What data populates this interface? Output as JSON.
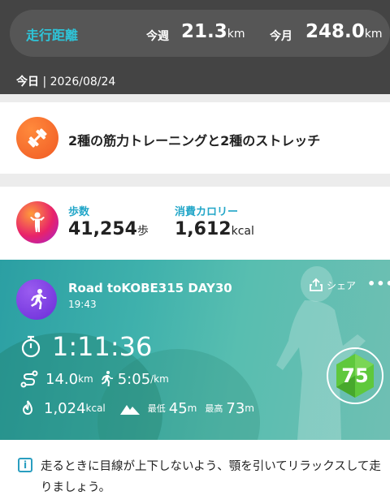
{
  "distance": {
    "label": "走行距離",
    "week_label": "今週",
    "week_value": "21.3",
    "week_unit": "km",
    "month_label": "今月",
    "month_value": "248.0",
    "month_unit": "km"
  },
  "today": {
    "label": "今日",
    "separator": " | ",
    "date": "2026/08/24"
  },
  "workout": {
    "icon": "dumbbell-icon",
    "title": "2種の筋力トレーニングと2種のストレッチ"
  },
  "activity": {
    "icon": "person-icon",
    "steps_label": "歩数",
    "steps_value": "41,254",
    "steps_unit": "歩",
    "calories_label": "消費カロリー",
    "calories_value": "1,612",
    "calories_unit": "kcal"
  },
  "run": {
    "icon": "running-icon",
    "title": "Road toKOBE315 DAY30",
    "time": "19:43",
    "share_label": "シェア",
    "more_label": "•••",
    "duration": "1:11:36",
    "distance_value": "14.0",
    "distance_unit": "km",
    "pace_value": "5:05",
    "pace_unit": "/km",
    "calories_value": "1,024",
    "calories_unit": "kcal",
    "elev_min_label": "最低",
    "elev_min_value": "45",
    "elev_min_unit": "m",
    "elev_max_label": "最高",
    "elev_max_value": "73",
    "elev_max_unit": "m",
    "score": "75",
    "accent_color": "#5fc83c"
  },
  "tip": {
    "icon": "info-icon",
    "text": "走るときに目線が上下しないよう、顎を引いてリラックスして走りましょう。"
  }
}
